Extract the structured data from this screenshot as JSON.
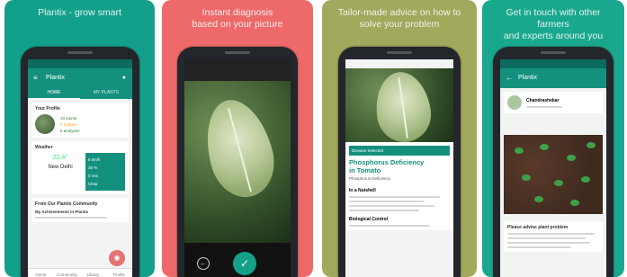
{
  "cards": [
    {
      "caption": "Plantix - grow smart",
      "bg": "#13a08b"
    },
    {
      "caption": "Instant diagnosis\nbased on your picture",
      "bg": "#ee6a6a"
    },
    {
      "caption": "Tailor-made advice on how to\nsolve your problem",
      "bg": "#a2a85c"
    },
    {
      "caption": "Get in touch with other farmers\nand experts around you",
      "bg": "#19a88e"
    }
  ],
  "screen1": {
    "app_title": "Plantix",
    "tabs": [
      "HOME",
      "MY PLANTS"
    ],
    "profile_title": "Your Profile",
    "stats": [
      "10 points",
      "2 badges",
      "5 analyses"
    ],
    "weather_title": "Weather",
    "temp": "22.4°",
    "city": "New Delhi",
    "weather_right": [
      "8 km/h",
      "35 %",
      "0 mm",
      "Clear"
    ],
    "community_title": "From Our Plantix Community",
    "community_item": "My Achievements in Plantix",
    "nav": [
      "Home",
      "Community",
      "Library",
      "Profile"
    ]
  },
  "screen3": {
    "selected": "Disease Selected",
    "title": "Phosphorus Deficiency\nin Tomato",
    "subtitle": "Phosphorus Deficiency",
    "section1": "In a Nutshell",
    "section2": "Biological Control"
  },
  "screen4": {
    "app_title": "Plantix",
    "user": "Chandrashekar",
    "question": "Please advise plant problem"
  },
  "colors": {
    "primary": "#14917e",
    "accent": "#e57373"
  }
}
